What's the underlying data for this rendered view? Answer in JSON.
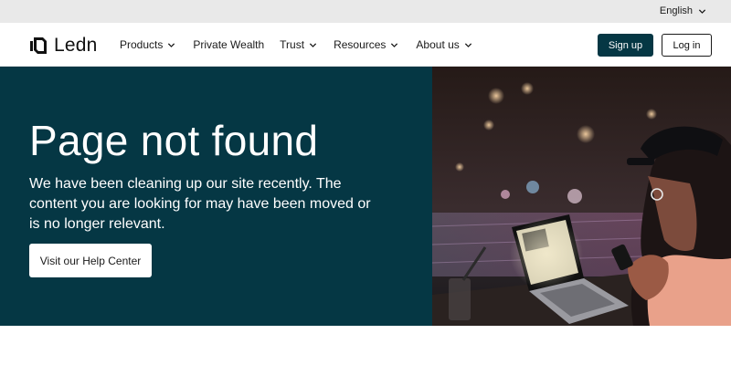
{
  "topbar": {
    "language": "English"
  },
  "nav": {
    "logo_text": "Ledn",
    "items": [
      {
        "label": "Products",
        "has_dropdown": true
      },
      {
        "label": "Private Wealth",
        "has_dropdown": false
      },
      {
        "label": "Trust",
        "has_dropdown": true
      },
      {
        "label": "Resources",
        "has_dropdown": true
      },
      {
        "label": "About us",
        "has_dropdown": true
      }
    ],
    "signup_label": "Sign up",
    "login_label": "Log in"
  },
  "hero": {
    "title": "Page not found",
    "subtitle": "We have been cleaning up our site recently. The content you are looking for may have been moved or is no longer relevant.",
    "cta_label": "Visit our Help Center"
  },
  "colors": {
    "brand_dark": "#053744",
    "topbar_bg": "#e9e9e9",
    "text": "#1a1a1a"
  },
  "icons": {
    "logo": "ledn-logo-icon",
    "dropdown": "chevron-down-icon"
  }
}
